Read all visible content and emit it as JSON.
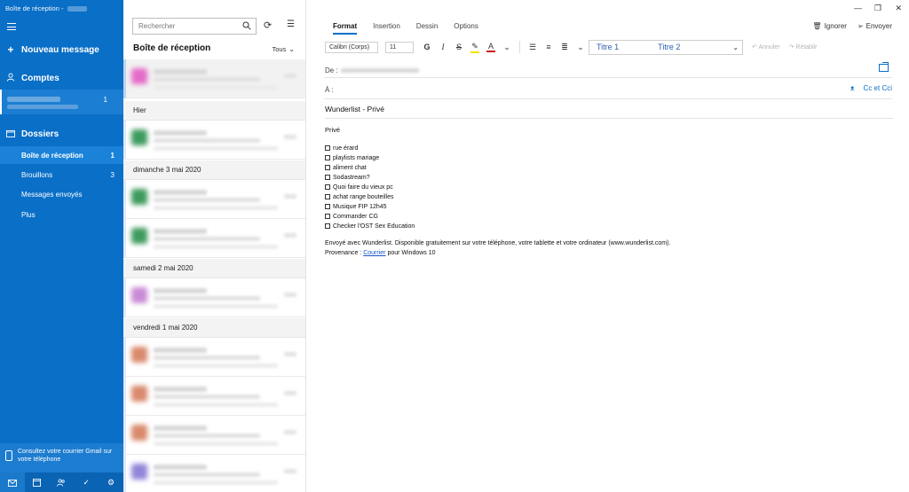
{
  "window": {
    "title": "Boîte de réception - "
  },
  "sidebar": {
    "new_message": "Nouveau message",
    "accounts_header": "Comptes",
    "account_count": "1",
    "folders_header": "Dossiers",
    "folders": [
      {
        "label": "Boîte de réception",
        "count": "1"
      },
      {
        "label": "Brouillons",
        "count": "3"
      },
      {
        "label": "Messages envoyés",
        "count": ""
      },
      {
        "label": "Plus",
        "count": ""
      }
    ],
    "promo": "Consultez votre courrier Gmail sur votre téléphone",
    "icons": [
      "mail-icon",
      "calendar-icon",
      "people-icon",
      "todo-icon",
      "settings-icon"
    ]
  },
  "list": {
    "search_placeholder": "Rechercher",
    "title": "Boîte de réception",
    "filter": "Tous",
    "groups": [
      "Hier",
      "dimanche 3 mai 2020",
      "samedi 2 mai 2020",
      "vendredi 1 mai 2020"
    ]
  },
  "compose": {
    "tabs": [
      "Format",
      "Insertion",
      "Dessin",
      "Options"
    ],
    "discard": "Ignorer",
    "send": "Envoyer",
    "font_name": "Calibri (Corps)",
    "font_size": "11",
    "bold": "G",
    "italic": "I",
    "strike": "S",
    "styles": [
      "Titre 1",
      "Titre 2"
    ],
    "undo": "Annuler",
    "redo": "Rétablir",
    "from_label": "De :",
    "to_label": "À :",
    "cc": "Cc et Cci",
    "subject": "Wunderlist - Privé",
    "body": {
      "heading": "Privé",
      "items": [
        "rue érard",
        "playlists mariage",
        "aliment chat",
        "Sodastream?",
        "Quoi faire du vieux pc",
        "achat range bouteilles",
        "Musique FIP 12h45",
        "Commander CG",
        "Checker l'OST Sex Education"
      ],
      "footer": "Envoyé avec Wunderlist. Disponible gratuitement sur votre téléphone, votre tablette et votre ordinateur (www.wunderlist.com).",
      "provenance_label": "Provenance : ",
      "provenance_link": "Courrier",
      "provenance_suffix": " pour Windows 10"
    }
  },
  "colors": {
    "sidebar_bg": "#0a6fc7",
    "accent": "#0a6fc7",
    "avatar_colors": [
      "#e46bc8",
      "#3e9a5e",
      "#3e9a5e",
      "#3e9a5e",
      "#c98bd6",
      "#d9896c",
      "#d9896c",
      "#d9896c",
      "#8f86d8"
    ]
  }
}
